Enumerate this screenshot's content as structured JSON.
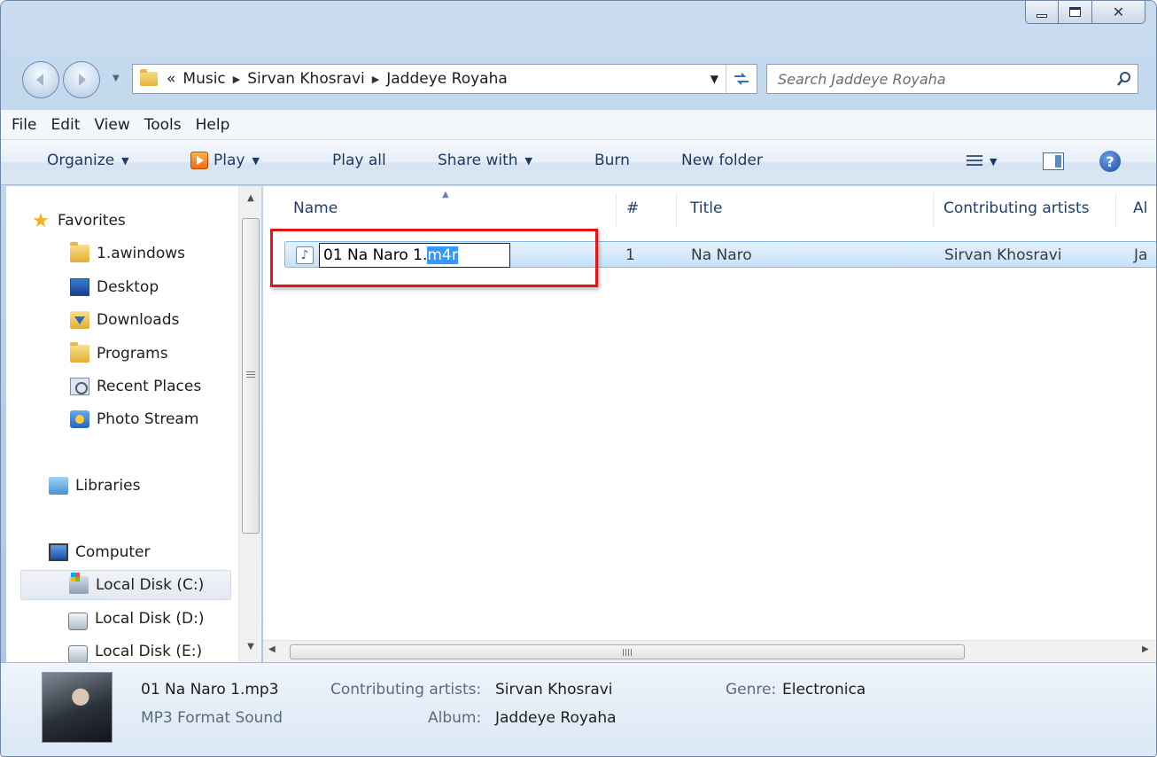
{
  "window": {
    "colors": {
      "accent": "#3399ff",
      "highlight_box": "#e01616",
      "selection": "#c7e2fa"
    }
  },
  "address_bar": {
    "overflow": "«",
    "crumbs": [
      "Music",
      "Sirvan Khosravi",
      "Jaddeye Royaha"
    ]
  },
  "search": {
    "placeholder": "Search Jaddeye Royaha"
  },
  "menu": [
    "File",
    "Edit",
    "View",
    "Tools",
    "Help"
  ],
  "toolbar": {
    "organize": "Organize",
    "play": "Play",
    "play_all": "Play all",
    "share_with": "Share with",
    "burn": "Burn",
    "new_folder": "New folder",
    "help_glyph": "?"
  },
  "nav_pane": {
    "favorites": "Favorites",
    "favorite_items": [
      "1.awindows",
      "Desktop",
      "Downloads",
      "Programs",
      "Recent Places",
      "Photo Stream"
    ],
    "libraries": "Libraries",
    "computer": "Computer",
    "drives": [
      "Local Disk (C:)",
      "Local Disk (D:)",
      "Local Disk (E:)"
    ]
  },
  "columns": {
    "name": "Name",
    "number": "#",
    "title": "Title",
    "contributing_artists": "Contributing artists",
    "album_partial": "Al"
  },
  "file": {
    "rename_base": "01 Na Naro 1.",
    "rename_selected": "m4r",
    "number": "1",
    "title": "Na Naro",
    "artist": "Sirvan Khosravi",
    "album_partial": "Ja"
  },
  "details": {
    "filename": "01 Na Naro 1.mp3",
    "type": "MP3 Format Sound",
    "contributing_artists_label": "Contributing artists:",
    "contributing_artists_value": "Sirvan Khosravi",
    "album_label": "Album:",
    "album_value": "Jaddeye Royaha",
    "genre_label": "Genre:",
    "genre_value": "Electronica"
  }
}
